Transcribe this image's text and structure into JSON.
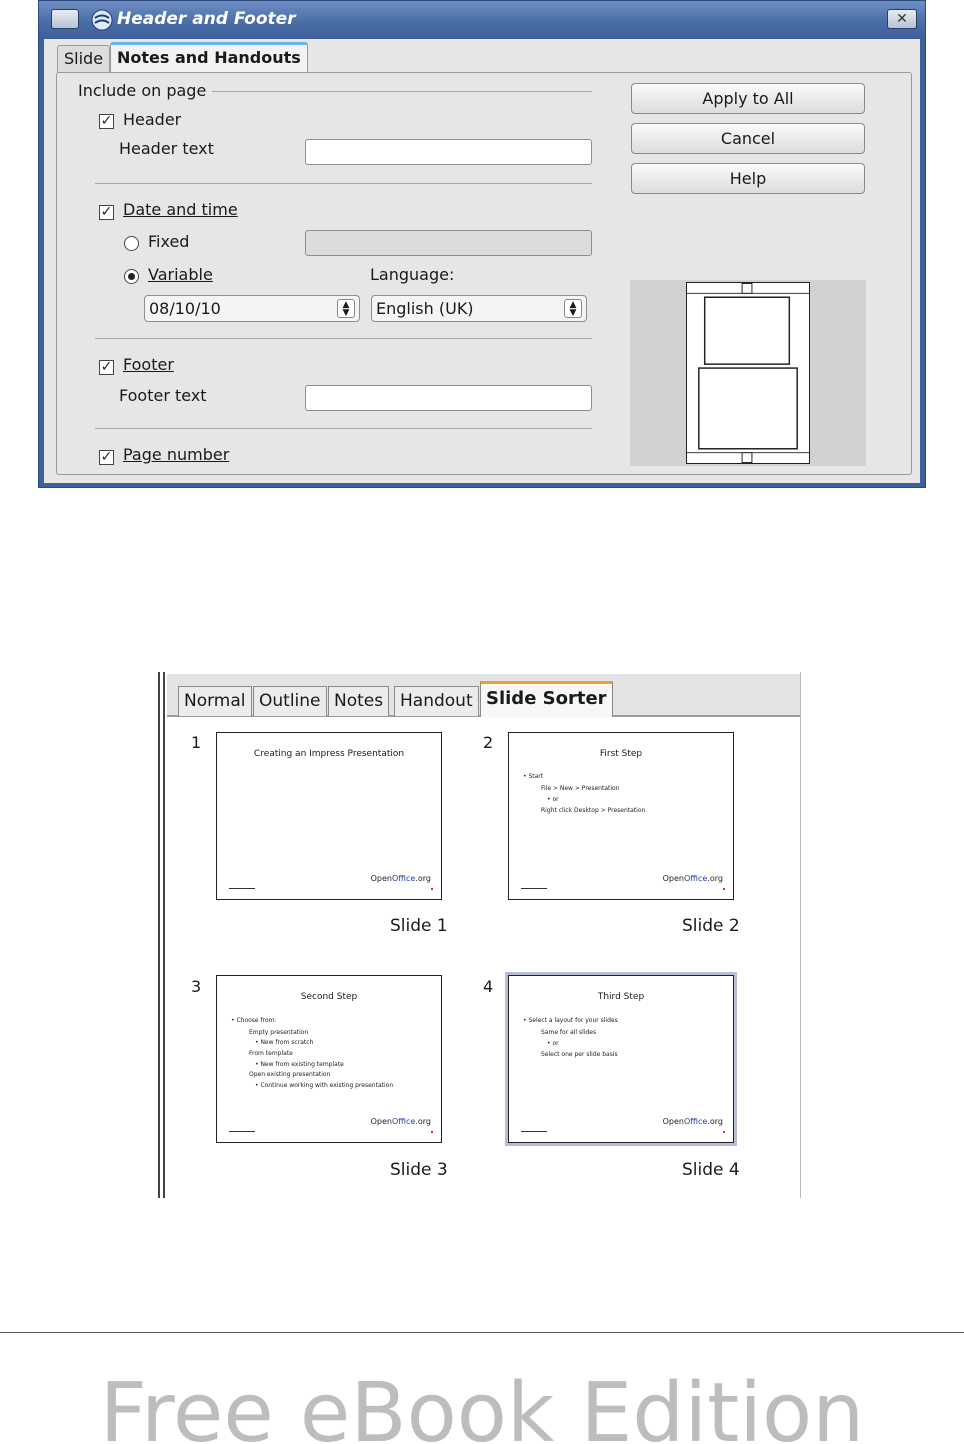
{
  "dialog": {
    "title": "Header and Footer",
    "close_glyph": "✕",
    "tabs": [
      "Slide",
      "Notes and Handouts"
    ],
    "active_tab": "Notes and Handouts",
    "group_label": "Include on page",
    "header": {
      "label": "Header",
      "checked": true,
      "text_label": "Header text",
      "text_value": ""
    },
    "date_time": {
      "label": "Date and time",
      "checked": true,
      "fixed_label": "Fixed",
      "fixed_value": "",
      "variable_label": "Variable",
      "selected": "Variable",
      "format_value": "08/10/10",
      "language_label": "Language:",
      "language_value": "English (UK)"
    },
    "footer": {
      "label": "Footer",
      "checked": true,
      "text_label": "Footer text",
      "text_value": ""
    },
    "page_number": {
      "label": "Page number",
      "checked": true
    },
    "buttons": {
      "apply_all": "Apply to All",
      "cancel": "Cancel",
      "help": "Help"
    },
    "icons": {
      "menu": "window-menu-icon",
      "app": "openoffice-icon",
      "close": "close-icon"
    }
  },
  "sorter": {
    "tabs": [
      "Normal",
      "Outline",
      "Notes",
      "Handout",
      "Slide Sorter"
    ],
    "active_tab": "Slide Sorter",
    "slides": [
      {
        "number": "1",
        "caption": "Slide 1",
        "title": "Creating an Impress Presentation",
        "lines": []
      },
      {
        "number": "2",
        "caption": "Slide 2",
        "title": "First Step",
        "lines": [
          "• Start",
          "File > New > Presentation",
          "• or",
          "Right click Desktop > Presentation"
        ]
      },
      {
        "number": "3",
        "caption": "Slide 3",
        "title": "Second Step",
        "lines": [
          "• Choose from:",
          "Empty presentation",
          "• New from scratch",
          "From template",
          "• New from existing template",
          "Open existing presentation",
          "• Continue working with existing presentation"
        ]
      },
      {
        "number": "4",
        "caption": "Slide 4",
        "title": "Third Step",
        "lines": [
          "• Select a layout for your slides",
          "Same for all slides",
          "• or",
          "Select one per slide basis"
        ]
      }
    ],
    "logo_text_1": "Open",
    "logo_text_2": "Office",
    "logo_text_3": ".org"
  },
  "edition_text": "Free eBook Edition"
}
